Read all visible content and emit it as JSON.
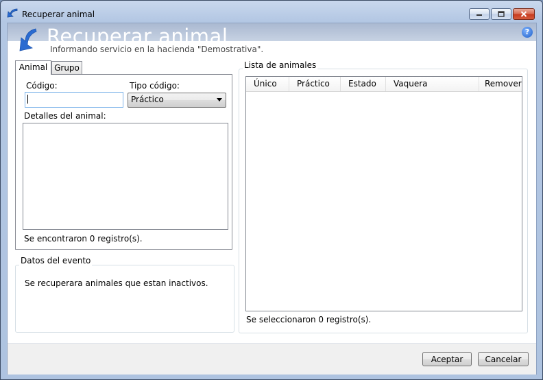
{
  "window": {
    "title": "Recuperar animal"
  },
  "header": {
    "title": "Recuperar animal",
    "subtitle": "Informando servicio en la hacienda \"Demostrativa\".",
    "help_glyph": "?"
  },
  "tabs": [
    {
      "label": "Animal",
      "active": true
    },
    {
      "label": "Grupo",
      "active": false
    }
  ],
  "animal_tab": {
    "codigo_label": "Código:",
    "codigo_value": "",
    "tipo_codigo_label": "Tipo código:",
    "tipo_codigo_value": "Práctico",
    "detalles_label": "Detalles del animal:",
    "records_text": "Se encontraron 0 registro(s)."
  },
  "datos_evento": {
    "title": "Datos del evento",
    "text": "Se recuperara animales que estan inactivos."
  },
  "lista_animales": {
    "title": "Lista de animales",
    "columns": [
      "Único",
      "Práctico",
      "Estado",
      "Vaquera",
      "Remover"
    ],
    "rows": [],
    "records_text": "Se seleccionaron 0 registro(s)."
  },
  "footer": {
    "accept_label": "Aceptar",
    "cancel_label": "Cancelar"
  },
  "icons": {
    "title": "back-arrow-icon",
    "header": "back-arrow-icon",
    "help": "help-icon",
    "minimize": "minimize-icon",
    "maximize": "maximize-icon",
    "close": "close-icon"
  }
}
